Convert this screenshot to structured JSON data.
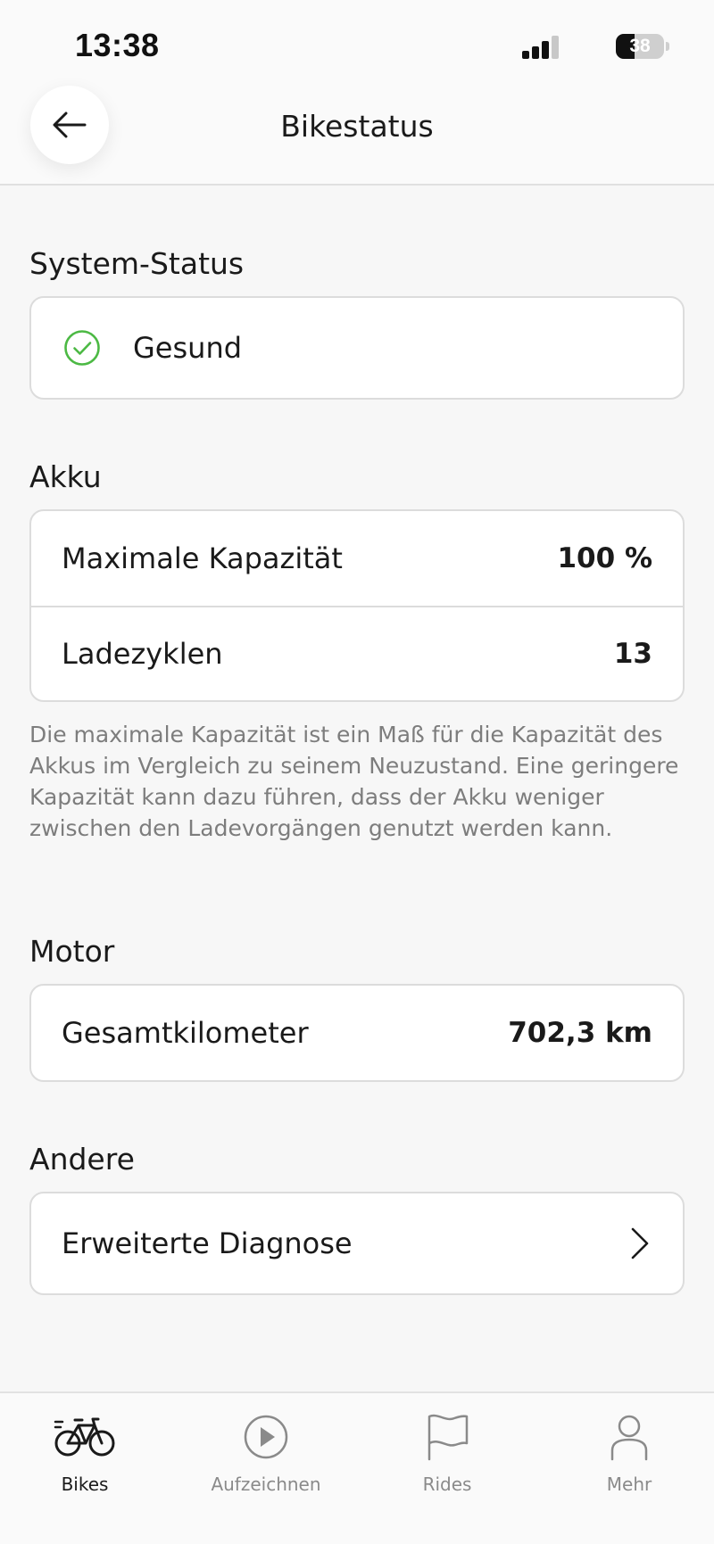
{
  "status_bar": {
    "time": "13:38",
    "battery_level": "38",
    "battery_fraction": 0.38
  },
  "header": {
    "title": "Bikestatus",
    "back_icon": "arrow-left-icon"
  },
  "system_status": {
    "title": "System-Status",
    "value": "Gesund",
    "icon": "check-circle-icon",
    "icon_color": "#4cb944"
  },
  "akku": {
    "title": "Akku",
    "rows": [
      {
        "label": "Maximale Kapazität",
        "value": "100 %"
      },
      {
        "label": "Ladezyklen",
        "value": "13"
      }
    ],
    "note": "Die maximale Kapazität ist ein Maß für die Kapazität des Akkus im Vergleich zu seinem Neuzustand. Eine geringere Kapazität kann dazu führen, dass der Akku weniger zwischen den Ladevorgängen genutzt werden kann."
  },
  "motor": {
    "title": "Motor",
    "rows": [
      {
        "label": "Gesamtkilometer",
        "value": "702,3 km"
      }
    ]
  },
  "andere": {
    "title": "Andere",
    "rows": [
      {
        "label": "Erweiterte Diagnose",
        "icon": "chevron-right-icon"
      }
    ]
  },
  "tabbar": {
    "tabs": [
      {
        "label": "Bikes",
        "icon": "bike-icon",
        "active": true
      },
      {
        "label": "Aufzeichnen",
        "icon": "play-circle-icon",
        "active": false
      },
      {
        "label": "Rides",
        "icon": "flag-icon",
        "active": false
      },
      {
        "label": "Mehr",
        "icon": "person-icon",
        "active": false
      }
    ]
  },
  "colors": {
    "background": "#f7f7f7",
    "card": "#ffffff",
    "accent_green": "#4cb944",
    "text": "#1a1a1a",
    "muted_text": "#7d7d7d"
  }
}
